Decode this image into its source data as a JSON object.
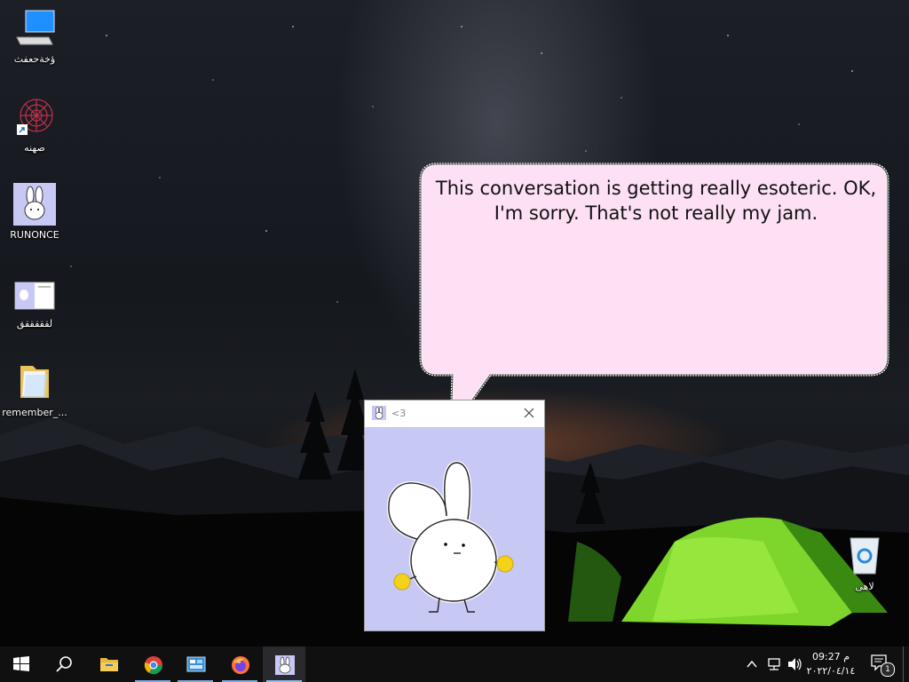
{
  "desktop": {
    "icons": [
      {
        "label": "ؤخةحعفث",
        "icon": "computer-icon"
      },
      {
        "label": "صهنه",
        "icon": "spiral-shortcut-icon"
      },
      {
        "label": "RUNONCE",
        "icon": "bunny-app-icon"
      },
      {
        "label": "لقققققق",
        "icon": "bunny-image-icon"
      },
      {
        "label": "remember_...",
        "icon": "folder-icon"
      },
      {
        "label": "لاهى",
        "icon": "recycle-bin-icon"
      }
    ]
  },
  "bubble": {
    "text": "This conversation is getting really esoteric. OK, I'm sorry. That's not really my jam.",
    "fill": "#fde0f4",
    "border": "#ffffff"
  },
  "window": {
    "title": "<3",
    "background": "#c8c8f4",
    "character": "white-bunny"
  },
  "taskbar": {
    "items": [
      "start-icon",
      "search-icon",
      "file-explorer-icon",
      "chrome-icon",
      "control-panel-icon",
      "firefox-icon",
      "bunny-taskbar-icon"
    ],
    "tray": {
      "time": "09:27",
      "ampm": "م",
      "date": "٢٠٢٢/٠٤/١٤",
      "notification_count": "1"
    }
  }
}
